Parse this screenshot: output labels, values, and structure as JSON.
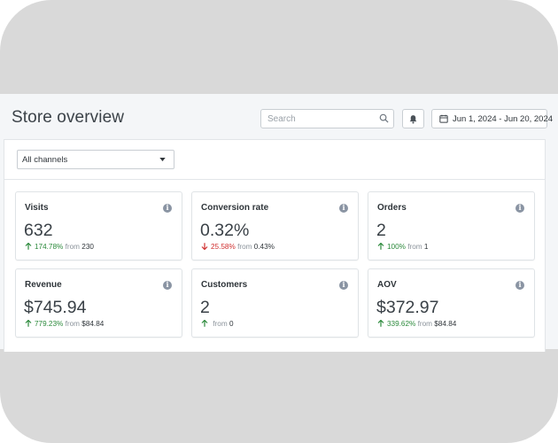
{
  "header": {
    "title": "Store overview",
    "search_placeholder": "Search",
    "date_range": "Jun 1, 2024 - Jun 20, 2024"
  },
  "filters": {
    "channel": "All channels"
  },
  "metrics": [
    {
      "label": "Visits",
      "value": "632",
      "direction": "up",
      "pct": "174.78%",
      "from_label": "from",
      "prev": "230"
    },
    {
      "label": "Conversion rate",
      "value": "0.32%",
      "direction": "down",
      "pct": "25.58%",
      "from_label": "from",
      "prev": "0.43%"
    },
    {
      "label": "Orders",
      "value": "2",
      "direction": "up",
      "pct": "100%",
      "from_label": "from",
      "prev": "1"
    },
    {
      "label": "Revenue",
      "value": "$745.94",
      "direction": "up",
      "pct": "779.23%",
      "from_label": "from",
      "prev": "$84.84"
    },
    {
      "label": "Customers",
      "value": "2",
      "direction": "up",
      "pct": "",
      "from_label": "from",
      "prev": "0"
    },
    {
      "label": "AOV",
      "value": "$372.97",
      "direction": "up",
      "pct": "339.62%",
      "from_label": "from",
      "prev": "$84.84"
    }
  ],
  "icons": {
    "search": "search-icon",
    "bell": "bell-icon",
    "calendar": "calendar-icon",
    "dropdown": "caret-down-icon",
    "info": "info-icon",
    "up": "arrow-up-icon",
    "down": "arrow-down-icon"
  },
  "colors": {
    "up": "#2c8a3c",
    "down": "#d02f2f",
    "background": "#f4f6f8",
    "info": "#8a94a3"
  }
}
